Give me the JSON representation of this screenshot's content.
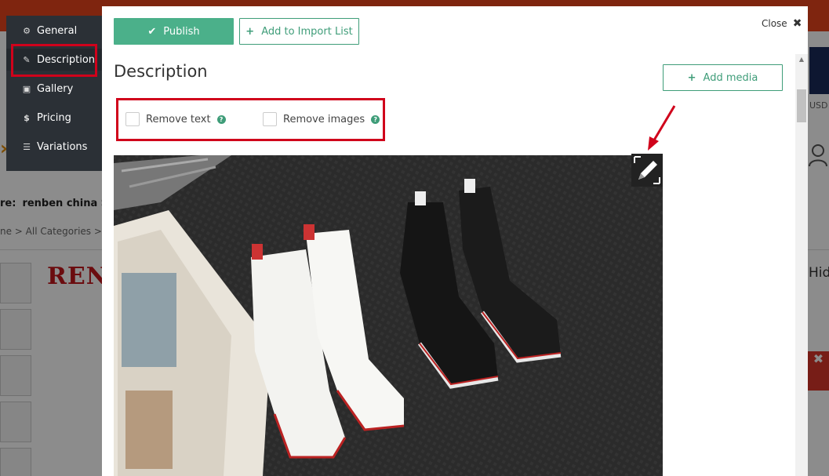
{
  "background": {
    "store_label": "re:",
    "store_name": "renben china Sto",
    "breadcrumb": "ne > All Categories > S",
    "brand_partial": "REN",
    "currency_partial": "USD",
    "hide_partial": "Hid",
    "close_partial": "✖"
  },
  "sidenav": {
    "items": [
      {
        "label": "General",
        "icon": "gear-icon"
      },
      {
        "label": "Description",
        "icon": "pencil-icon"
      },
      {
        "label": "Gallery",
        "icon": "image-icon"
      },
      {
        "label": "Pricing",
        "icon": "dollar-icon"
      },
      {
        "label": "Variations",
        "icon": "list-icon"
      }
    ],
    "active_index": 1
  },
  "modal": {
    "publish_label": "Publish",
    "import_label": "Add to Import List",
    "close_label": "Close",
    "close_glyph": "✖",
    "title": "Description",
    "add_media_label": "Add media",
    "options": [
      {
        "label": "Remove text",
        "checked": false
      },
      {
        "label": "Remove images",
        "checked": false
      }
    ]
  },
  "colors": {
    "accent": "#4bb08a",
    "highlight": "#d0021b",
    "nav_bg": "#2b3036"
  }
}
